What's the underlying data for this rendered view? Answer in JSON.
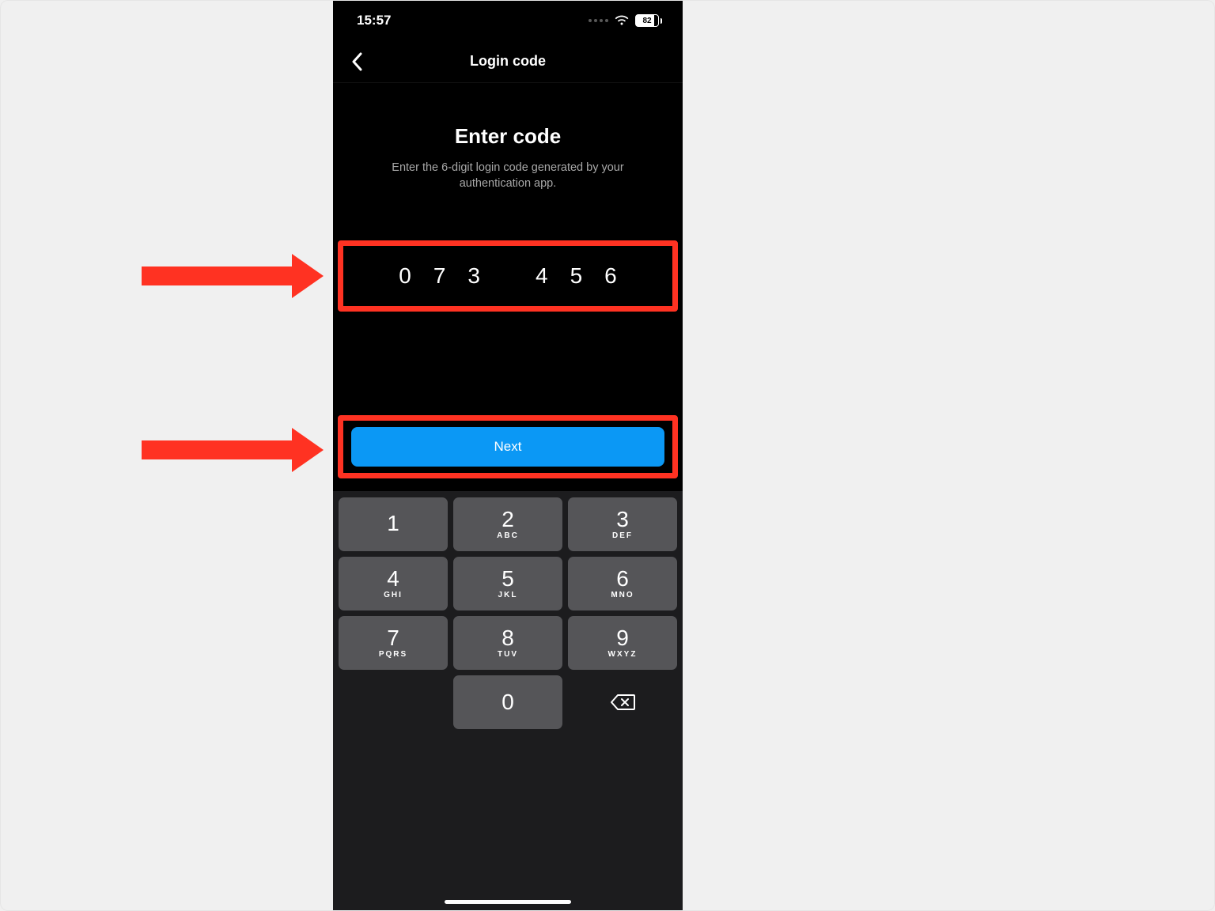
{
  "statusbar": {
    "time": "15:57",
    "battery": "82"
  },
  "nav": {
    "title": "Login code"
  },
  "main": {
    "heading": "Enter code",
    "subtitle": "Enter the 6-digit login code generated by your authentication app."
  },
  "code": {
    "d0": "0",
    "d1": "7",
    "d2": "3",
    "d3": "4",
    "d4": "5",
    "d5": "6"
  },
  "buttons": {
    "next": "Next"
  },
  "keypad": {
    "k1": {
      "n": "1",
      "l": ""
    },
    "k2": {
      "n": "2",
      "l": "ABC"
    },
    "k3": {
      "n": "3",
      "l": "DEF"
    },
    "k4": {
      "n": "4",
      "l": "GHI"
    },
    "k5": {
      "n": "5",
      "l": "JKL"
    },
    "k6": {
      "n": "6",
      "l": "MNO"
    },
    "k7": {
      "n": "7",
      "l": "PQRS"
    },
    "k8": {
      "n": "8",
      "l": "TUV"
    },
    "k9": {
      "n": "9",
      "l": "WXYZ"
    },
    "k0": {
      "n": "0",
      "l": ""
    }
  }
}
